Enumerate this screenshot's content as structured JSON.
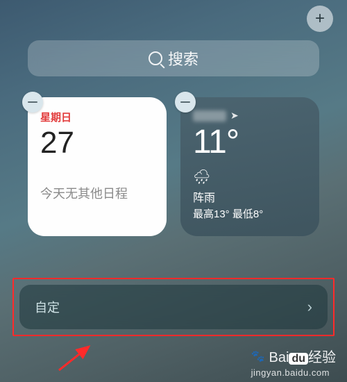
{
  "header": {
    "add_glyph": "+"
  },
  "search": {
    "placeholder": "搜索"
  },
  "widgets": {
    "calendar": {
      "weekday": "星期日",
      "date": "27",
      "note": "今天无其他日程"
    },
    "weather": {
      "location_arrow": "➤",
      "temp": "11°",
      "condition_icon": "🌧",
      "condition": "阵雨",
      "hilo": "最高13° 最低8°"
    }
  },
  "footer": {
    "customize": "自定",
    "chevron": "›"
  },
  "watermark": {
    "brand_pre": "Bai",
    "brand_box": "du",
    "brand_post": "经验",
    "sub": "jingyan.baidu.com"
  },
  "colors": {
    "highlight": "#ff2a2a"
  }
}
